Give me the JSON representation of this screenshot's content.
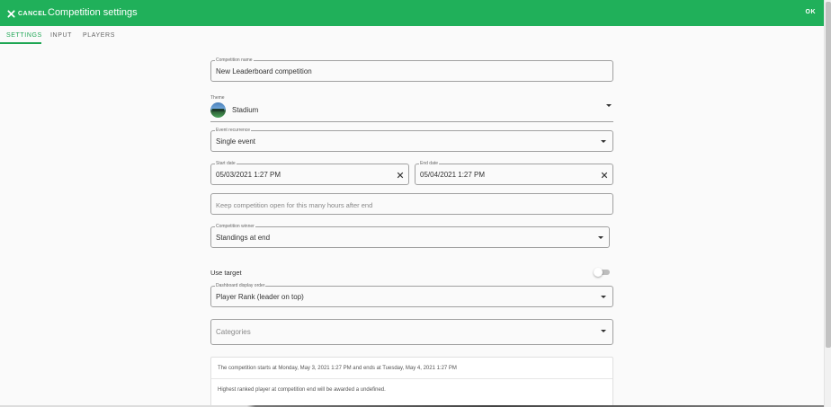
{
  "header": {
    "cancel_label": "CANCEL",
    "title": "Competition settings",
    "ok_label": "OK",
    "bar_color": "#20b05a"
  },
  "tabs": [
    {
      "label": "SETTINGS",
      "active": true
    },
    {
      "label": "INPUT",
      "active": false
    },
    {
      "label": "PLAYERS",
      "active": false
    }
  ],
  "form": {
    "competition_name": {
      "label": "Competition name",
      "value": "New Leaderboard competition"
    },
    "theme": {
      "label": "Theme",
      "value": "Stadium",
      "icon": "stadium-thumbnail"
    },
    "event_recurrence": {
      "label": "Event recurrence",
      "value": "Single event"
    },
    "start_date": {
      "label": "Start date",
      "value": "05/03/2021 1:27 PM"
    },
    "end_date": {
      "label": "End date",
      "value": "05/04/2021 1:27 PM"
    },
    "keep_open": {
      "placeholder": "Keep competition open for this many hours after end"
    },
    "competition_winner": {
      "label": "Competition winner",
      "value": "Standings at end"
    },
    "use_target": {
      "label": "Use target",
      "enabled": false
    },
    "dashboard_order": {
      "label": "Dashboard display order",
      "value": "Player Rank (leader on top)"
    },
    "categories": {
      "placeholder": "Categories"
    }
  },
  "summary": {
    "line1": "The competition starts at Monday, May 3, 2021 1:27 PM and ends at Tuesday, May 4, 2021 1:27 PM",
    "line2": "Highest ranked player at competition end will be awarded a undefined."
  }
}
